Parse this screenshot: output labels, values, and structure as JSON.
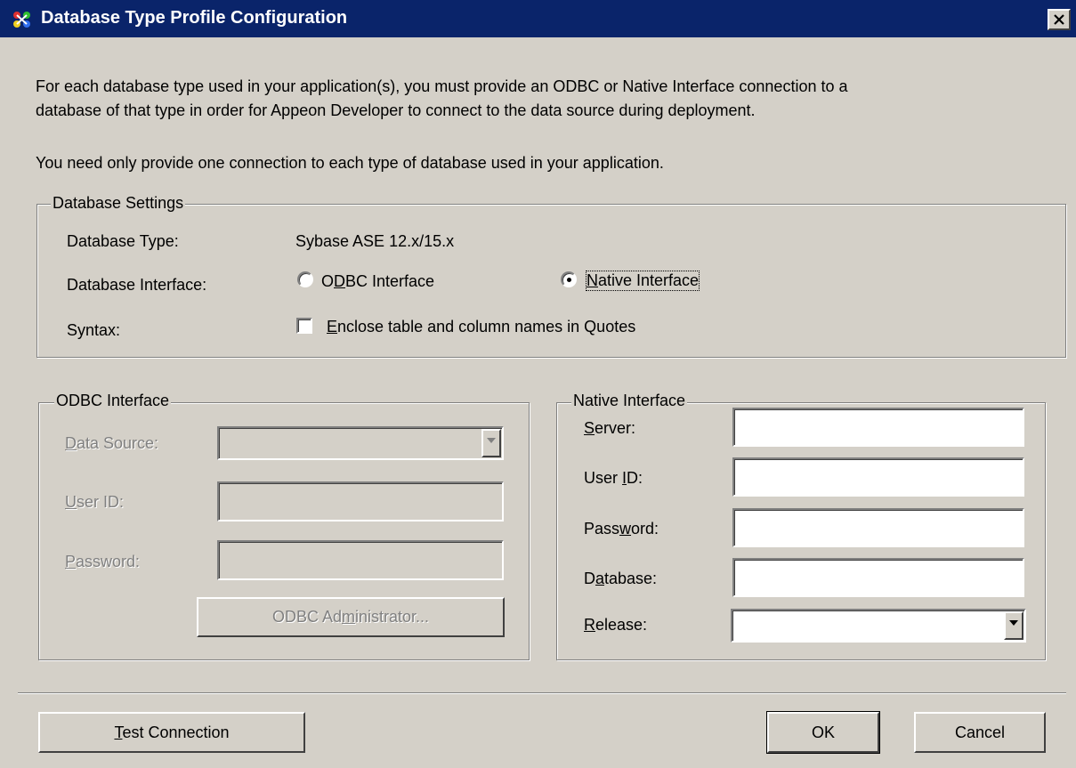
{
  "window": {
    "title": "Database Type Profile Configuration",
    "app_icon": "appeon-icon",
    "close_icon": "close-icon"
  },
  "intro": {
    "line1": "For each database type used in your application(s), you must provide an ODBC or Native Interface connection to a",
    "line2": "database of that type in order for Appeon Developer to connect to the data source during deployment.",
    "line3": "You need only provide one connection to each type of database used in your application."
  },
  "database_settings": {
    "group_label": "Database Settings",
    "type_label": "Database Type:",
    "type_value": "Sybase ASE 12.x/15.x",
    "interface_label": "Database Interface:",
    "odbc_option": {
      "pre": "O",
      "key": "D",
      "post": "BC Interface",
      "selected": false
    },
    "native_option": {
      "pre": "",
      "key": "N",
      "post": "ative Interface",
      "selected": true
    },
    "syntax_label": "Syntax:",
    "quotes_checkbox": {
      "pre": "",
      "key": "E",
      "post": "nclose table and column names in Quotes",
      "checked": false
    }
  },
  "odbc_interface": {
    "group_label": "ODBC Interface",
    "data_source_label": {
      "pre": "",
      "key": "D",
      "post": "ata Source:"
    },
    "data_source_value": "",
    "user_id_label": {
      "pre": "",
      "key": "U",
      "post": "ser ID:"
    },
    "user_id_value": "",
    "password_label": {
      "pre": "",
      "key": "P",
      "post": "assword:"
    },
    "password_value": "",
    "admin_button": {
      "pre": "ODBC Ad",
      "key": "m",
      "post": "inistrator..."
    }
  },
  "native_interface": {
    "group_label": "Native Interface",
    "server_label": {
      "pre": "",
      "key": "S",
      "post": "erver:"
    },
    "server_value": "",
    "user_id_label": {
      "pre": "User ",
      "key": "I",
      "post": "D:"
    },
    "user_id_value": "",
    "password_label": {
      "pre": "Pass",
      "key": "w",
      "post": "ord:"
    },
    "password_value": "",
    "database_label": {
      "pre": "D",
      "key": "a",
      "post": "tabase:"
    },
    "database_value": "",
    "release_label": {
      "pre": "",
      "key": "R",
      "post": "elease:"
    },
    "release_value": ""
  },
  "buttons": {
    "test_connection": {
      "pre": "",
      "key": "T",
      "post": "est Connection"
    },
    "ok": "OK",
    "cancel": "Cancel"
  }
}
